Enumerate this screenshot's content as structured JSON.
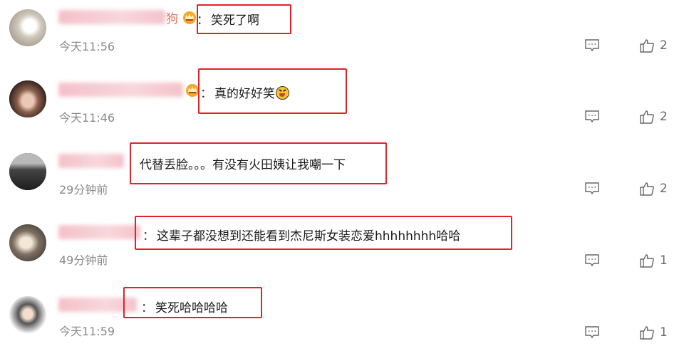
{
  "comments": [
    {
      "user_suffix": "狗",
      "text": "笑死了啊",
      "has_crown": true,
      "time": "今天11:56",
      "likes": "2"
    },
    {
      "user_suffix": "",
      "text": "真的好好笑",
      "has_crown": true,
      "emoji": "laughing-emoji",
      "time": "今天11:46",
      "likes": "2"
    },
    {
      "user_suffix": "",
      "text": "代替丢脸。。。有没有火田姨让我嘲一下",
      "has_crown": false,
      "time": "29分钟前",
      "likes": "2"
    },
    {
      "user_suffix": "",
      "text": "这辈子都没想到还能看到杰尼斯女装恋爱hhhhhhhh哈哈",
      "has_crown": false,
      "time": "49分钟前",
      "likes": "1"
    },
    {
      "user_suffix": "",
      "text": "笑死哈哈哈哈",
      "has_crown": false,
      "time": "今天11:59",
      "likes": "1"
    }
  ],
  "colon": "：",
  "icons": {
    "reply": "comment-icon",
    "like": "thumbs-up-icon",
    "crown": "vip-crown-icon"
  },
  "colors": {
    "highlight_box": "#e0222a",
    "username": "#e8705f",
    "time": "#8a8a8a"
  }
}
